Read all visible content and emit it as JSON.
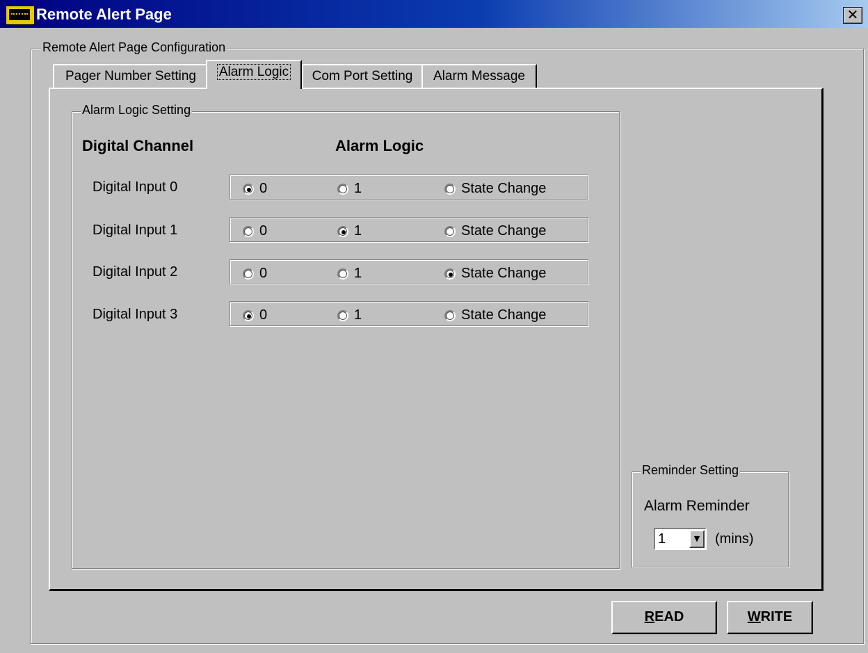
{
  "window": {
    "title": "Remote Alert Page",
    "close_glyph": "✕"
  },
  "config_group": {
    "legend": "Remote Alert Page Configuration"
  },
  "tabs": [
    {
      "label": "Pager Number Setting",
      "active": false
    },
    {
      "label": "Alarm Logic",
      "active": true
    },
    {
      "label": "Com Port Setting",
      "active": false
    },
    {
      "label": "Alarm Message",
      "active": false
    }
  ],
  "alarm_logic": {
    "legend": "Alarm Logic Setting",
    "col_channel": "Digital Channel",
    "col_logic": "Alarm Logic",
    "options": [
      "0",
      "1",
      "State Change"
    ],
    "rows": [
      {
        "label": "Digital Input 0",
        "selected": 0
      },
      {
        "label": "Digital Input 1",
        "selected": 1
      },
      {
        "label": "Digital Input 2",
        "selected": 2
      },
      {
        "label": "Digital Input 3",
        "selected": 0
      }
    ]
  },
  "reminder": {
    "legend": "Reminder Setting",
    "label": "Alarm Reminder",
    "value": "1",
    "unit": "(mins)"
  },
  "buttons": {
    "read_ul": "R",
    "read_rest": "EAD",
    "write_ul": "W",
    "write_rest": "RITE"
  },
  "colors": {
    "face": "#c0c0c0",
    "title_start": "#000080",
    "title_end": "#a6caf0"
  }
}
